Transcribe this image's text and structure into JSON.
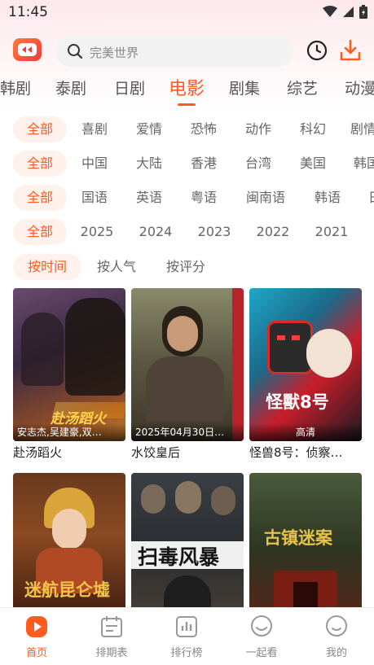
{
  "status": {
    "time": "11:45"
  },
  "search": {
    "placeholder": "完美世界"
  },
  "categories": [
    "韩剧",
    "泰剧",
    "日剧",
    "电影",
    "剧集",
    "综艺",
    "动漫"
  ],
  "active_category": "电影",
  "filters": {
    "genre": [
      "全部",
      "喜剧",
      "爱情",
      "恐怖",
      "动作",
      "科幻",
      "剧情"
    ],
    "region": [
      "全部",
      "中国",
      "大陆",
      "香港",
      "台湾",
      "美国",
      "韩国"
    ],
    "language": [
      "全部",
      "国语",
      "英语",
      "粤语",
      "闽南语",
      "韩语",
      "日"
    ],
    "year": [
      "全部",
      "2025",
      "2024",
      "2023",
      "2022",
      "2021"
    ],
    "sort": [
      "按时间",
      "按人气",
      "按评分"
    ]
  },
  "movies": [
    {
      "title": "赴汤蹈火",
      "overlay": "安志杰,吴建豪,双…",
      "poster_text": "赴汤蹈火"
    },
    {
      "title": "水饺皇后",
      "overlay": "2025年04月30日…",
      "poster_text": ""
    },
    {
      "title": "怪兽8号：侦察…",
      "overlay": "高清",
      "poster_text": "怪獸8号"
    },
    {
      "title": "",
      "overlay": "",
      "poster_text": "迷航昆仑墟"
    },
    {
      "title": "",
      "overlay": "",
      "poster_text": "扫毒风暴"
    },
    {
      "title": "",
      "overlay": "",
      "poster_text": "古镇迷案"
    }
  ],
  "tabs": [
    {
      "label": "首页",
      "icon": "home-play-icon",
      "active": true
    },
    {
      "label": "排期表",
      "icon": "calendar-icon"
    },
    {
      "label": "排行榜",
      "icon": "chart-icon"
    },
    {
      "label": "一起看",
      "icon": "smile-icon"
    },
    {
      "label": "我的",
      "icon": "profile-icon"
    }
  ],
  "colors": {
    "accent": "#ff5a1f",
    "chip_bg": "#fff1ec"
  }
}
